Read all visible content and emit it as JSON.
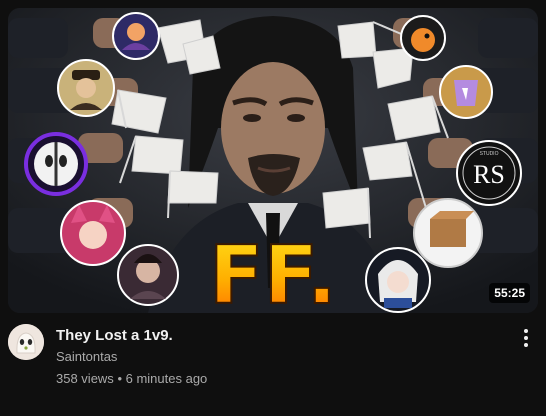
{
  "video": {
    "title": "They Lost a 1v9.",
    "channel": "Saintontas",
    "views": "358 views",
    "separator": "•",
    "age": "6 minutes ago",
    "duration": "55:25"
  },
  "thumbnail": {
    "overlay_text": "FF.",
    "logo_text": "RS",
    "logo_ring_text": "STUDIO"
  },
  "icons": {
    "more": "vertical-ellipsis-icon",
    "channel_avatar": "ghost-face-avatar"
  },
  "colors": {
    "background": "#0f0f0f",
    "title": "#f1f1f1",
    "secondary": "#aaaaaa",
    "ff_top": "#ffdc1a",
    "ff_bottom": "#ff7a00"
  }
}
